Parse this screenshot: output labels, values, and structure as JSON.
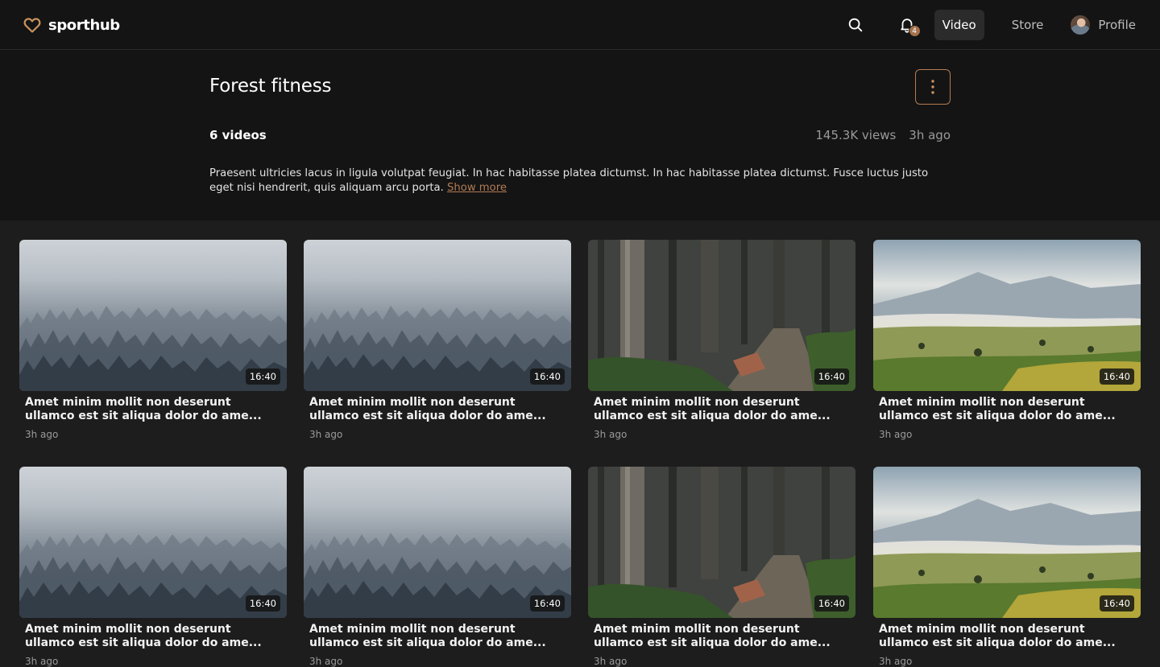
{
  "header": {
    "logo_text": "sporthub",
    "notification_count": "4",
    "nav": {
      "video": "Video",
      "store": "Store",
      "profile": "Profile"
    }
  },
  "playlist": {
    "title": "Forest fitness",
    "video_count": "6 videos",
    "views": "145.3K views",
    "posted": "3h ago",
    "description": "Praesent ultricies lacus in ligula volutpat feugiat. In hac habitasse platea dictumst. In hac habitasse platea dictumst. Fusce luctus justo eget nisi hendrerit, quis aliquam arcu porta.",
    "show_more": "Show more"
  },
  "videos": [
    {
      "title": "Amet minim mollit non deserunt ullamco est sit aliqua dolor do ame...",
      "duration": "16:40",
      "time": "3h ago",
      "thumbnail": "misty-forest"
    },
    {
      "title": "Amet minim mollit non deserunt ullamco est sit aliqua dolor do ame...",
      "duration": "16:40",
      "time": "3h ago",
      "thumbnail": "misty-forest"
    },
    {
      "title": "Amet minim mollit non deserunt ullamco est sit aliqua dolor do ame...",
      "duration": "16:40",
      "time": "3h ago",
      "thumbnail": "forest-trail"
    },
    {
      "title": "Amet minim mollit non deserunt ullamco est sit aliqua dolor do ame...",
      "duration": "16:40",
      "time": "3h ago",
      "thumbnail": "mountain-meadow"
    },
    {
      "title": "Amet minim mollit non deserunt ullamco est sit aliqua dolor do ame...",
      "duration": "16:40",
      "time": "3h ago",
      "thumbnail": "misty-forest"
    },
    {
      "title": "Amet minim mollit non deserunt ullamco est sit aliqua dolor do ame...",
      "duration": "16:40",
      "time": "3h ago",
      "thumbnail": "misty-forest"
    },
    {
      "title": "Amet minim mollit non deserunt ullamco est sit aliqua dolor do ame...",
      "duration": "16:40",
      "time": "3h ago",
      "thumbnail": "forest-trail"
    },
    {
      "title": "Amet minim mollit non deserunt ullamco est sit aliqua dolor do ame...",
      "duration": "16:40",
      "time": "3h ago",
      "thumbnail": "mountain-meadow"
    }
  ],
  "colors": {
    "accent": "#b07b55",
    "background": "#141414",
    "grid_background": "#1d1d1d"
  }
}
